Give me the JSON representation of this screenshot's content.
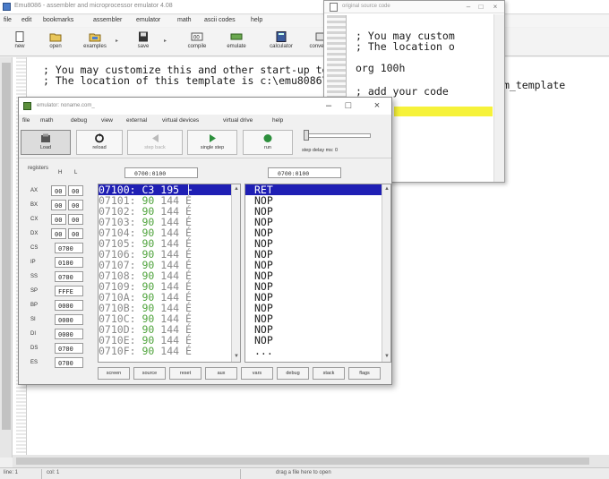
{
  "main_window": {
    "title": "Emu8086 - assembler and microprocessor emulator 4.08",
    "menu": [
      "file",
      "edit",
      "bookmarks",
      "assembler",
      "emulator",
      "math",
      "ascii codes",
      "help"
    ],
    "toolbar": [
      {
        "label": "new",
        "icon": "new-file-icon"
      },
      {
        "label": "open",
        "icon": "open-folder-icon"
      },
      {
        "label": "examples",
        "icon": "examples-icon"
      },
      {
        "label": "save",
        "icon": "save-icon"
      },
      {
        "label": "compile",
        "icon": "compile-icon"
      },
      {
        "label": "emulate",
        "icon": "emulate-icon"
      },
      {
        "label": "calculator",
        "icon": "calculator-icon"
      },
      {
        "label": "convertor",
        "icon": "convertor-icon"
      }
    ],
    "editor_lines": [
      "; You may customize this and other start-up templates;",
      "; The location of this template is c:\\emu8086\\inc\\0_com_template"
    ],
    "editor_tail": "m_template",
    "status": {
      "line": "line: 1",
      "col": "col: 1",
      "drag_hint": "drag a file here to open"
    }
  },
  "source_window": {
    "title": "original source code",
    "lines": [
      "; You may custom",
      "; The location o"
    ],
    "org": "org 100h",
    "add_code": "; add your code"
  },
  "emulator": {
    "title": "emulator: noname.com_",
    "menu": [
      "file",
      "math",
      "debug",
      "view",
      "external",
      "virtual devices",
      "virtual drive",
      "help"
    ],
    "toolbar": [
      {
        "label": "Load",
        "icon": "load-icon",
        "pressed": true
      },
      {
        "label": "reload",
        "icon": "reload-icon"
      },
      {
        "label": "step back",
        "icon": "step-back-icon",
        "disabled": true
      },
      {
        "label": "single step",
        "icon": "single-step-icon"
      },
      {
        "label": "run",
        "icon": "run-icon"
      }
    ],
    "speed_label": "step delay ms: 0",
    "registers_label": "registers",
    "hex_labels": [
      "H",
      "L"
    ],
    "mem_address": "0700:0100",
    "dis_address": "0700:0100",
    "registers": [
      {
        "name": "AX",
        "h": "00",
        "l": "00"
      },
      {
        "name": "BX",
        "h": "00",
        "l": "00"
      },
      {
        "name": "CX",
        "h": "00",
        "l": "00"
      },
      {
        "name": "DX",
        "h": "00",
        "l": "00"
      },
      {
        "name": "CS",
        "value": "0700"
      },
      {
        "name": "IP",
        "value": "0100"
      },
      {
        "name": "SS",
        "value": "0700"
      },
      {
        "name": "SP",
        "value": "FFFE"
      },
      {
        "name": "BP",
        "value": "0000"
      },
      {
        "name": "SI",
        "value": "0000"
      },
      {
        "name": "DI",
        "value": "0000"
      },
      {
        "name": "DS",
        "value": "0700"
      },
      {
        "name": "ES",
        "value": "0700"
      }
    ],
    "memory": [
      {
        "addr": "07100:",
        "op": "C3",
        "dec": "195",
        "ch": "├"
      },
      {
        "addr": "07101:",
        "op": "90",
        "dec": "144",
        "ch": "É"
      },
      {
        "addr": "07102:",
        "op": "90",
        "dec": "144",
        "ch": "É"
      },
      {
        "addr": "07103:",
        "op": "90",
        "dec": "144",
        "ch": "É"
      },
      {
        "addr": "07104:",
        "op": "90",
        "dec": "144",
        "ch": "É"
      },
      {
        "addr": "07105:",
        "op": "90",
        "dec": "144",
        "ch": "É"
      },
      {
        "addr": "07106:",
        "op": "90",
        "dec": "144",
        "ch": "É"
      },
      {
        "addr": "07107:",
        "op": "90",
        "dec": "144",
        "ch": "É"
      },
      {
        "addr": "07108:",
        "op": "90",
        "dec": "144",
        "ch": "É"
      },
      {
        "addr": "07109:",
        "op": "90",
        "dec": "144",
        "ch": "É"
      },
      {
        "addr": "0710A:",
        "op": "90",
        "dec": "144",
        "ch": "É"
      },
      {
        "addr": "0710B:",
        "op": "90",
        "dec": "144",
        "ch": "É"
      },
      {
        "addr": "0710C:",
        "op": "90",
        "dec": "144",
        "ch": "É"
      },
      {
        "addr": "0710D:",
        "op": "90",
        "dec": "144",
        "ch": "É"
      },
      {
        "addr": "0710E:",
        "op": "90",
        "dec": "144",
        "ch": "É"
      },
      {
        "addr": "0710F:",
        "op": "90",
        "dec": "144",
        "ch": "É"
      }
    ],
    "disassembly": [
      "RET",
      "NOP",
      "NOP",
      "NOP",
      "NOP",
      "NOP",
      "NOP",
      "NOP",
      "NOP",
      "NOP",
      "NOP",
      "NOP",
      "NOP",
      "NOP",
      "NOP",
      "..."
    ],
    "bottom_buttons": [
      "screen",
      "source",
      "reset",
      "aux",
      "vars",
      "debug",
      "stack",
      "flags"
    ]
  },
  "colors": {
    "selection": "#1f1fb4",
    "opcode_green": "#4fa33c",
    "highlight_yellow": "#f6f23a"
  }
}
